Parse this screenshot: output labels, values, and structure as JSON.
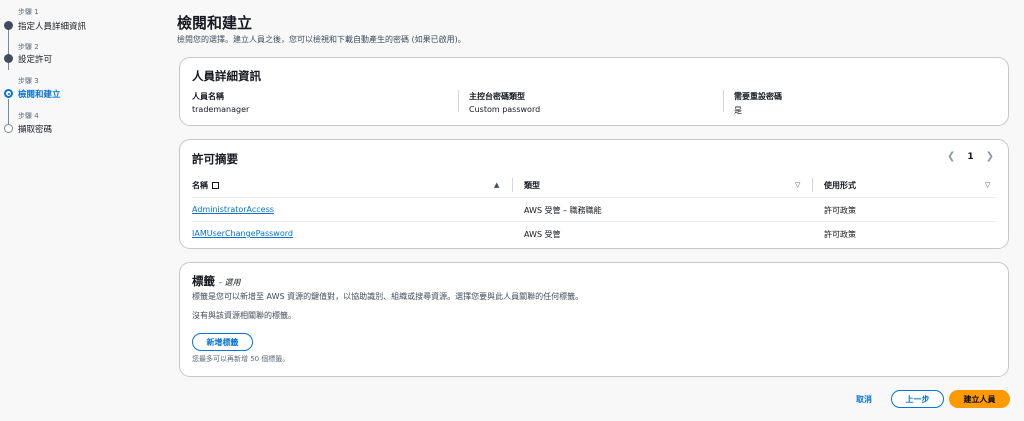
{
  "steps": [
    {
      "num": "步驟 1",
      "label": "指定人員詳細資訊"
    },
    {
      "num": "步驟 2",
      "label": "設定許可"
    },
    {
      "num": "步驟 3",
      "label": "檢閱和建立"
    },
    {
      "num": "步驟 4",
      "label": "擷取密碼"
    }
  ],
  "page": {
    "title": "檢閱和建立",
    "subtitle": "檢閱您的選擇。建立人員之後，您可以檢視和下載自動產生的密碼 (如果已啟用)。"
  },
  "user_details": {
    "heading": "人員詳細資訊",
    "fields": [
      {
        "key": "人員名稱",
        "value": "trademanager"
      },
      {
        "key": "主控台密碼類型",
        "value": "Custom password"
      },
      {
        "key": "需要重設密碼",
        "value": "是"
      }
    ]
  },
  "permissions": {
    "heading": "許可摘要",
    "page": "1",
    "columns": [
      "名稱",
      "類型",
      "使用形式"
    ],
    "rows": [
      {
        "name": "AdministratorAccess",
        "type": "AWS 受管 – 職務職能",
        "usage": "許可政策"
      },
      {
        "name": "IAMUserChangePassword",
        "type": "AWS 受管",
        "usage": "許可政策"
      }
    ]
  },
  "tags": {
    "heading": "標籤",
    "optional": "- 選用",
    "description": "標籤是您可以新增至 AWS 資源的鍵值對，以協助識別、組織或搜尋資源。選擇您要與此人員關聯的任何標籤。",
    "empty": "沒有與該資源相關聯的標籤。",
    "add_button": "新增標籤",
    "limit_note": "您最多可以再新增 50 個標籤。"
  },
  "footer": {
    "cancel": "取消",
    "previous": "上一步",
    "create": "建立人員"
  }
}
